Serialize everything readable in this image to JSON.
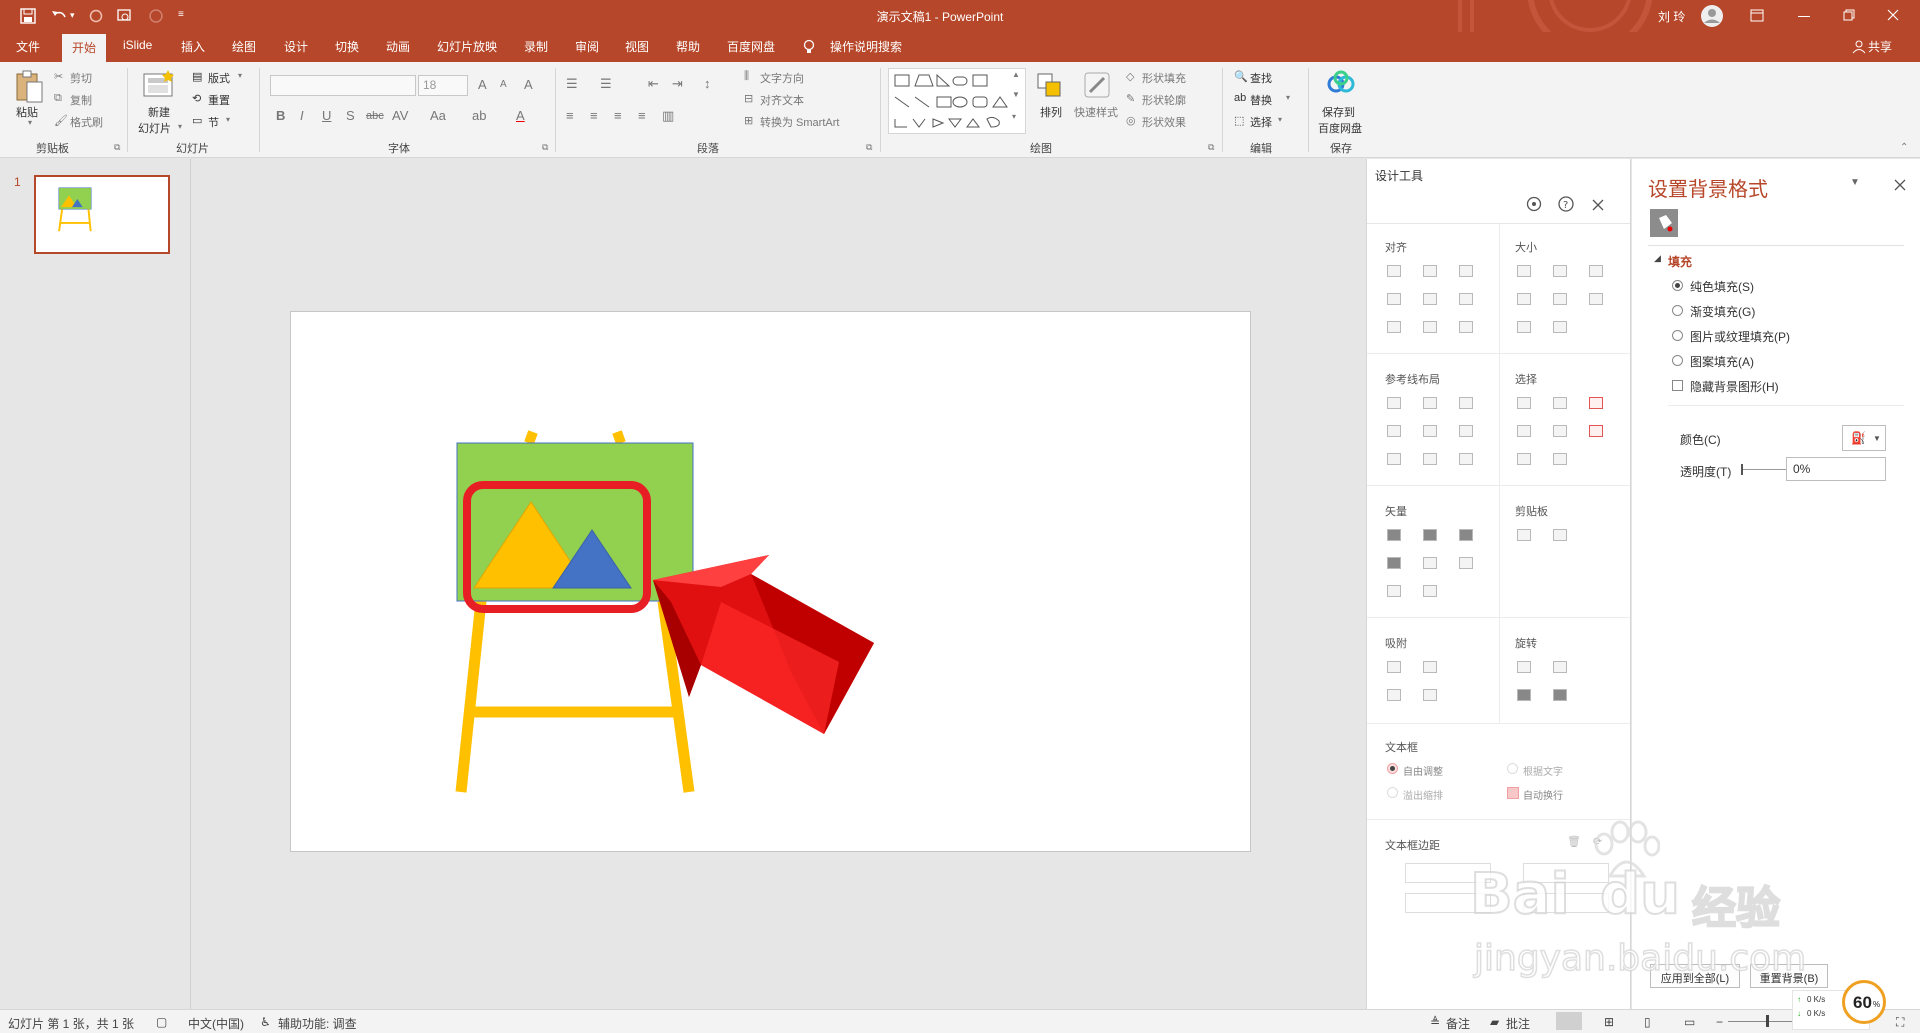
{
  "window": {
    "title": "演示文稿1  -  PowerPoint",
    "user": "刘 玲",
    "share_label": "共享",
    "colors": {
      "accent": "#b7472a",
      "ribbon_bg": "#f3f3f3"
    }
  },
  "quick_access": [
    "save-icon",
    "undo-icon",
    "redo-icon",
    "touch-mode-icon",
    "customize-icon"
  ],
  "tabs": [
    {
      "label": "文件"
    },
    {
      "label": "开始"
    },
    {
      "label": "iSlide"
    },
    {
      "label": "插入"
    },
    {
      "label": "绘图"
    },
    {
      "label": "设计"
    },
    {
      "label": "切换"
    },
    {
      "label": "动画"
    },
    {
      "label": "幻灯片放映"
    },
    {
      "label": "录制"
    },
    {
      "label": "审阅"
    },
    {
      "label": "视图"
    },
    {
      "label": "帮助"
    },
    {
      "label": "百度网盘"
    }
  ],
  "tell_me": "操作说明搜索",
  "ribbon": {
    "clipboard": {
      "paste": "粘贴",
      "cut": "剪切",
      "copy": "复制",
      "format_painter": "格式刷",
      "group": "剪贴板"
    },
    "slides": {
      "new_slide": "新建",
      "new_slide2": "幻灯片",
      "layout": "版式",
      "reset": "重置",
      "section": "节",
      "group": "幻灯片"
    },
    "font": {
      "size": "18",
      "group": "字体",
      "bold": "B",
      "italic": "I",
      "underline": "U",
      "shadow": "S",
      "strike": "abc",
      "spacing": "AV",
      "case": "Aa",
      "grow": "A",
      "shrink": "A",
      "clear": "A",
      "color": "A"
    },
    "paragraph": {
      "text_direction": "文字方向",
      "align_text": "对齐文本",
      "smartart": "转换为 SmartArt",
      "group": "段落"
    },
    "drawing": {
      "arrange": "排列",
      "quick_styles": "快速样式",
      "shape_fill": "形状填充",
      "shape_outline": "形状轮廓",
      "shape_effects": "形状效果",
      "group": "绘图"
    },
    "editing": {
      "find": "查找",
      "replace": "替换",
      "select": "选择",
      "group": "编辑"
    },
    "save": {
      "label1": "保存到",
      "label2": "百度网盘",
      "group": "保存"
    }
  },
  "thumbnails": {
    "number": "1"
  },
  "design_tools": {
    "title": "设计工具",
    "sections": {
      "align": "对齐",
      "size": "大小",
      "guides": "参考线布局",
      "select": "选择",
      "vector": "矢量",
      "clipboard": "剪贴板",
      "snap": "吸附",
      "rotate": "旋转",
      "textbox": "文本框",
      "textbox_margin": "文本框边距"
    },
    "textbox_options": {
      "auto_fit": "自由调整",
      "fit_text": "根据文字",
      "overflow": "溢出缩排",
      "wrap": "自动换行"
    }
  },
  "format_background": {
    "title": "设置背景格式",
    "section": "填充",
    "options": [
      {
        "label": "纯色填充(S)",
        "selected": true
      },
      {
        "label": "渐变填充(G)",
        "selected": false
      },
      {
        "label": "图片或纹理填充(P)",
        "selected": false
      },
      {
        "label": "图案填充(A)",
        "selected": false
      }
    ],
    "hide_bg": "隐藏背景图形(H)",
    "color_label": "颜色(C)",
    "transparency_label": "透明度(T)",
    "transparency_value": "0%",
    "apply_all": "应用到全部(L)",
    "reset": "重置背景(B)"
  },
  "status": {
    "slide_info": "幻灯片 第 1 张，共 1 张",
    "language": "中文(中国)",
    "accessibility": "辅助功能: 调查",
    "notes": "备注",
    "comments": "批注",
    "net_up": "0 K/s",
    "net_down": "0 K/s",
    "percent": "60"
  },
  "watermark": {
    "line1": "Bai",
    "line2": "du",
    "cn": "经验",
    "url": "jingyan.baidu.com"
  }
}
